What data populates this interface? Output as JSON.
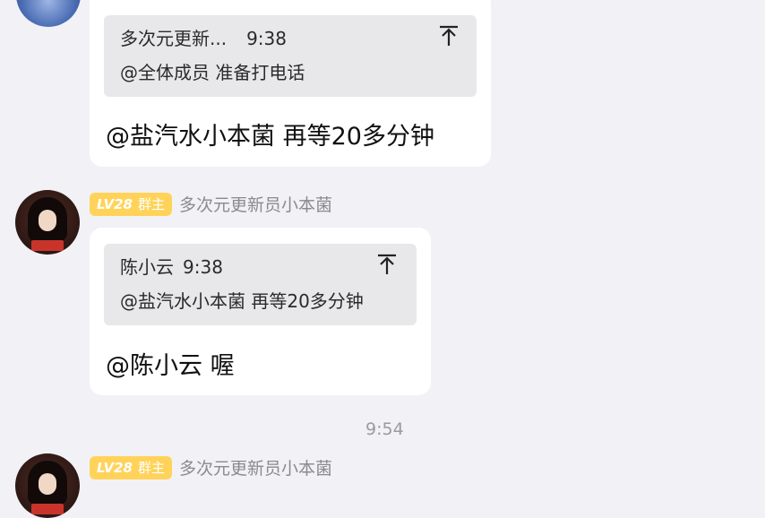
{
  "messages": [
    {
      "quote": {
        "sender": "多次元更新...",
        "time": "9:38",
        "text": "@全体成员 准备打电话"
      },
      "text": "@盐汽水小本菌 再等20多分钟"
    },
    {
      "badge": {
        "level": "LV28",
        "role": "群主"
      },
      "sender_name": "多次元更新员小本菌",
      "quote": {
        "sender": "陈小云",
        "time": "9:38",
        "text": "@盐汽水小本菌 再等20多分钟"
      },
      "text": "@陈小云 喔"
    },
    {
      "badge": {
        "level": "LV28",
        "role": "群主"
      },
      "sender_name": "多次元更新员小本菌"
    }
  ],
  "timestamp": "9:54",
  "icons": {
    "quote_jump": "arrow-up-to-top-icon",
    "avatar": "user-avatar"
  },
  "colors": {
    "background": "#f2f1f6",
    "bubble": "#ffffff",
    "quote": "#e8e8ea",
    "badge": "#ffd35a"
  }
}
